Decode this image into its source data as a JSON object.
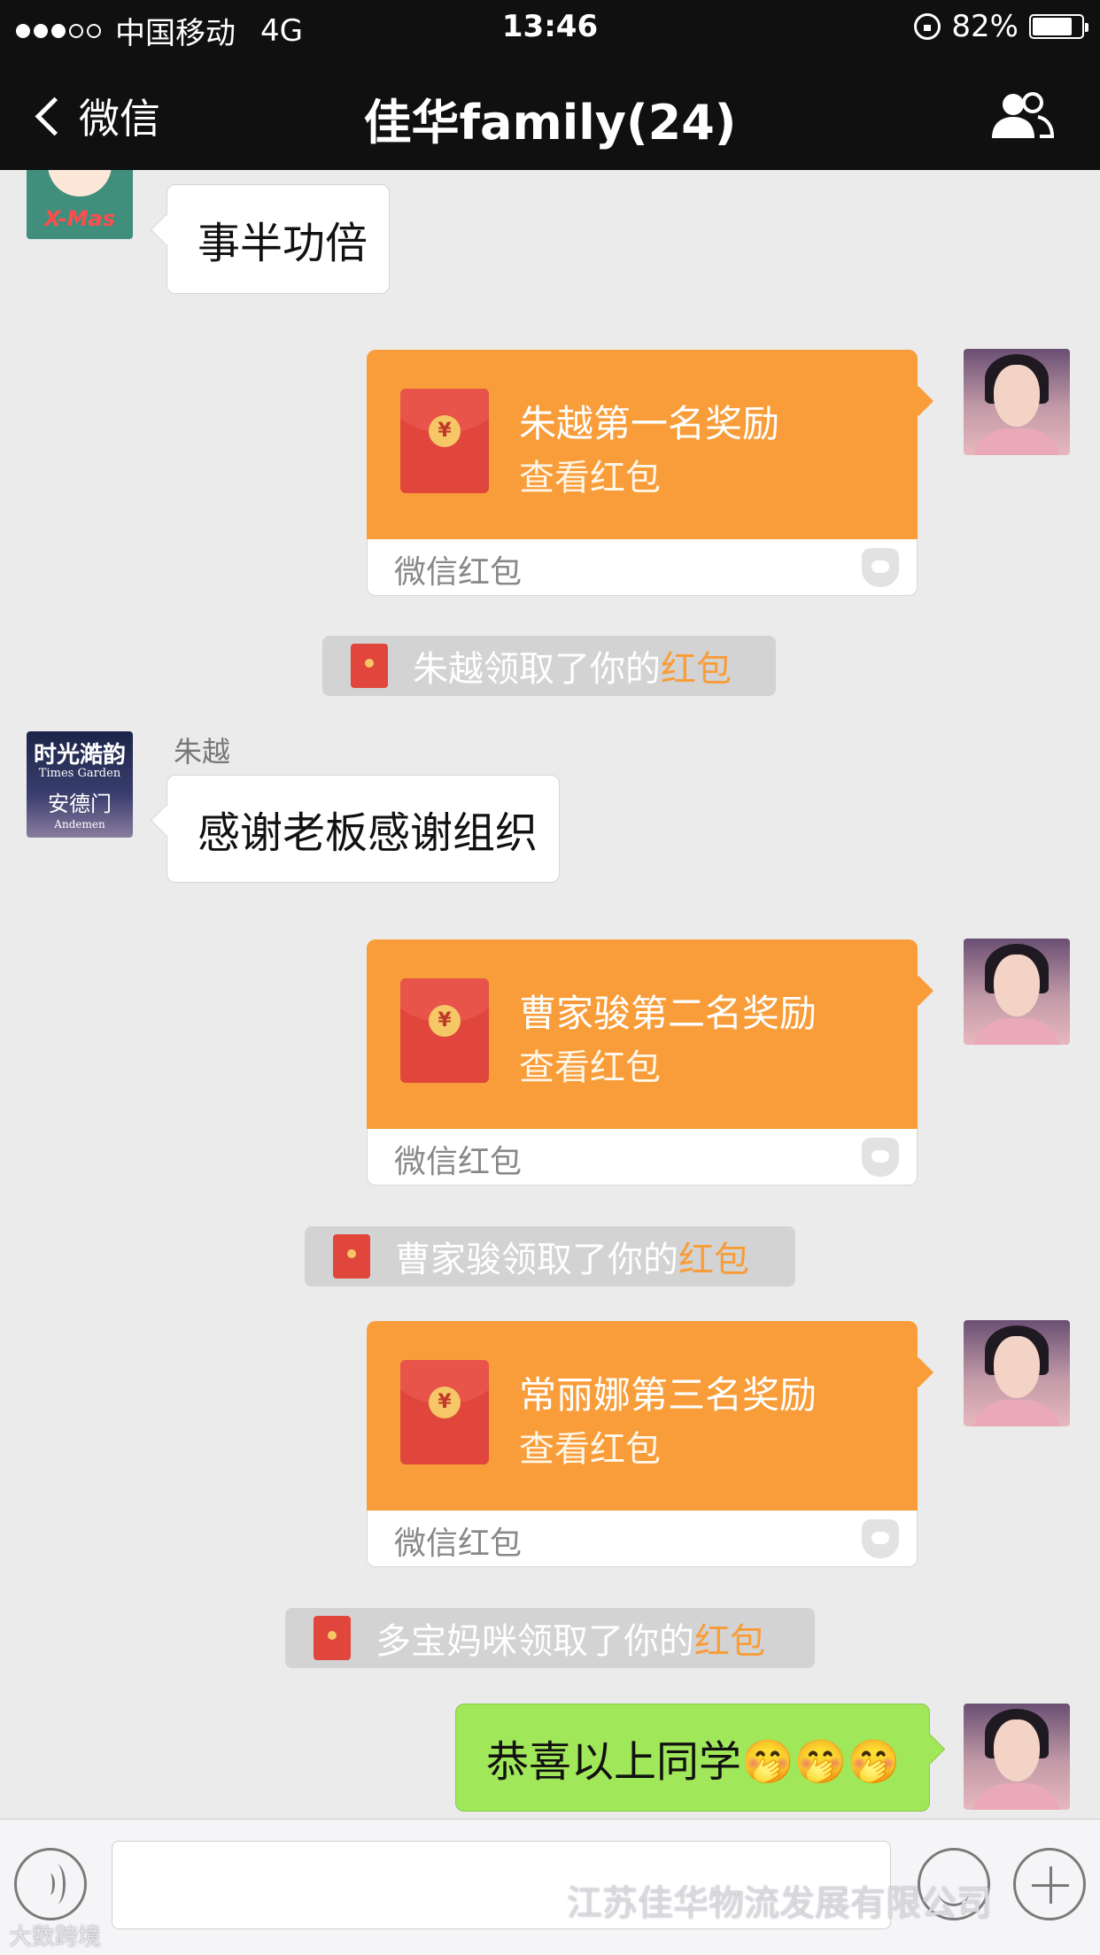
{
  "status_bar": {
    "carrier": "中国移动",
    "network": "4G",
    "time": "13:46",
    "battery": "82%",
    "battery_level": 0.82
  },
  "nav": {
    "back_label": "微信",
    "title": "佳华family(24)",
    "right_icon": "group-members-icon"
  },
  "messages": [
    {
      "type": "text",
      "side": "left",
      "text": "事半功倍"
    },
    {
      "type": "red_packet",
      "side": "right",
      "title": "朱越第一名奖励",
      "sub": "查看红包",
      "footer": "微信红包"
    },
    {
      "type": "system",
      "prefix": "朱越领取了你的",
      "highlight": "红包"
    },
    {
      "type": "text",
      "side": "left",
      "sender": "朱越",
      "text": "感谢老板感谢组织",
      "avatar_lines": [
        "时光澔韵",
        "Times Garden",
        "安德门",
        "Andemen"
      ]
    },
    {
      "type": "red_packet",
      "side": "right",
      "title": "曹家骏第二名奖励",
      "sub": "查看红包",
      "footer": "微信红包"
    },
    {
      "type": "system",
      "prefix": "曹家骏领取了你的",
      "highlight": "红包"
    },
    {
      "type": "red_packet",
      "side": "right",
      "title": "常丽娜第三名奖励",
      "sub": "查看红包",
      "footer": "微信红包"
    },
    {
      "type": "system",
      "prefix": "多宝妈咪领取了你的",
      "highlight": "红包"
    },
    {
      "type": "text",
      "side": "right",
      "text": "恭喜以上同学🤭🤭🤭"
    }
  ],
  "xmas_avatar_text": "X-Mas",
  "coin_symbol": "¥",
  "watermark": "江苏佳华物流发展有限公司",
  "watermark_small": "大数跨境",
  "colors": {
    "red_packet": "#f89d39",
    "highlight": "#f89d39",
    "self_bubble": "#a0e75a"
  }
}
